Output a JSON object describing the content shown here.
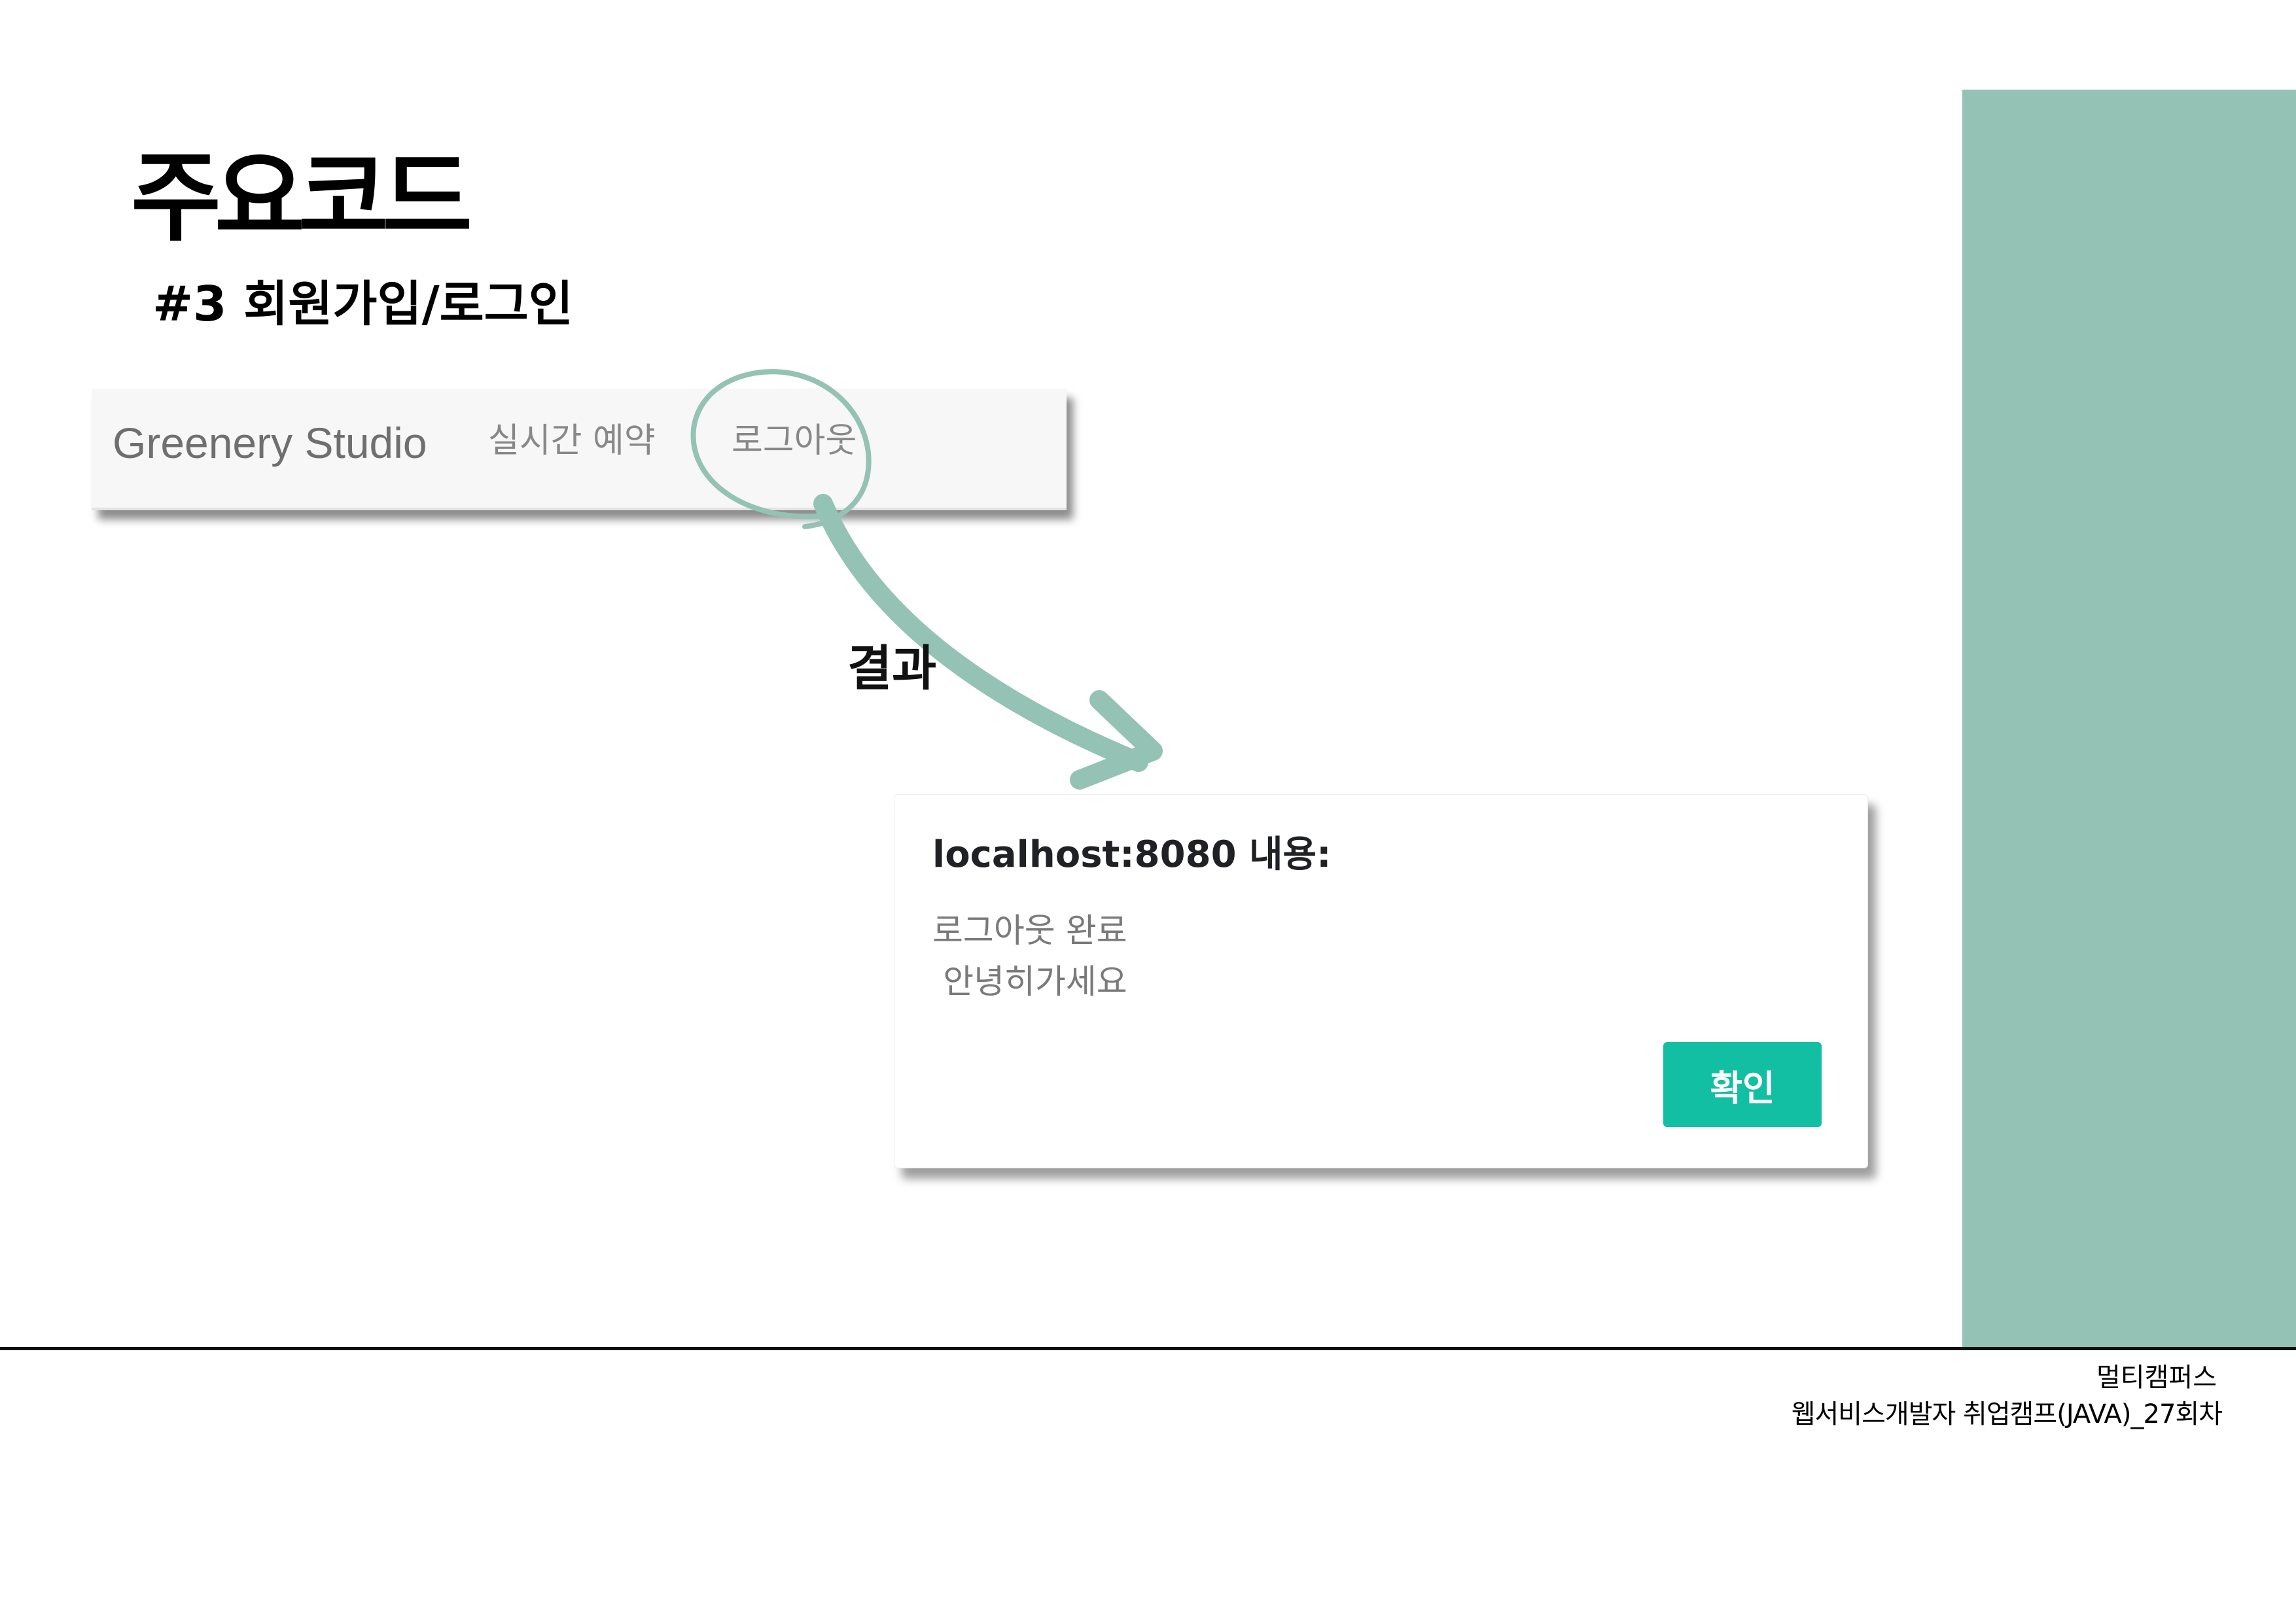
{
  "colors": {
    "accent": "#94c2b5",
    "button": "#12bfa3",
    "navbar_bg": "#f7f7f7"
  },
  "header": {
    "title": "주요코드",
    "subtitle": "#3 회원가입/로그인"
  },
  "navbar": {
    "brand": "Greenery Studio",
    "links": [
      "실시간 예약",
      "로그아웃"
    ]
  },
  "annotation": {
    "label": "결과"
  },
  "dialog": {
    "title": "localhost:8080 내용:",
    "message": "로그아웃 완료\n 안녕히가세요",
    "ok_label": "확인"
  },
  "footer": {
    "brand": "멀티캠퍼스",
    "course": "웹서비스개발자 취업캠프(JAVA)_27회차"
  }
}
